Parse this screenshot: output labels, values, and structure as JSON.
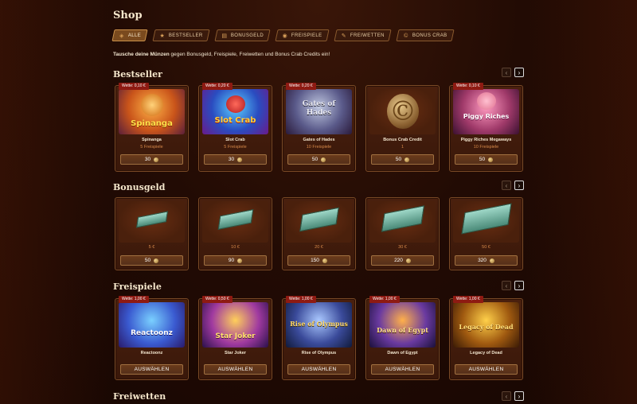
{
  "shop_title": "Shop",
  "filters": [
    {
      "label": "ALLE",
      "icon": "tag-icon",
      "active": true
    },
    {
      "label": "BESTSELLER",
      "icon": "star-icon",
      "active": false
    },
    {
      "label": "BONUSGELD",
      "icon": "cash-icon",
      "active": false
    },
    {
      "label": "FREISPIELE",
      "icon": "spin-coin-icon",
      "active": false
    },
    {
      "label": "FREIWETTEN",
      "icon": "ticket-icon",
      "active": false
    },
    {
      "label": "BONUS CRAB",
      "icon": "crab-coin-icon",
      "active": false
    }
  ],
  "intro": {
    "bold": "Tausche deine Münzen",
    "rest": " gegen Bonusgeld, Freispiele, Freiwetten und Bonus Crab Credits ein!"
  },
  "nav": {
    "prev": "‹",
    "next": "›"
  },
  "sections": {
    "bestseller": {
      "title": "Bestseller",
      "items": [
        {
          "badge": "Wette: 0,10 €",
          "art": "Spinanga",
          "name": "Spinanga",
          "sub": "5 Freispiele",
          "price": "30"
        },
        {
          "badge": "Wette: 0,20 €",
          "art": "Slot Crab",
          "name": "Slot Crab",
          "sub": "5 Freispiele",
          "price": "30"
        },
        {
          "badge": "Wette: 0,20 €",
          "art": "Gates of Hades",
          "name": "Gates of Hades",
          "sub": "10 Freispiele",
          "price": "50"
        },
        {
          "badge": "",
          "art": "",
          "name": "Bonus Crab Credit",
          "sub": "1",
          "price": "50"
        },
        {
          "badge": "Wette: 0,10 €",
          "art": "Piggy Riches",
          "name": "Piggy Riches Megaways",
          "sub": "10 Freispiele",
          "price": "50"
        }
      ]
    },
    "bonusgeld": {
      "title": "Bonusgeld",
      "items": [
        {
          "amount": "5 €",
          "price": "50"
        },
        {
          "amount": "10 €",
          "price": "90"
        },
        {
          "amount": "20 €",
          "price": "150"
        },
        {
          "amount": "30 €",
          "price": "220"
        },
        {
          "amount": "50 €",
          "price": "320"
        }
      ]
    },
    "freispiele": {
      "title": "Freispiele",
      "action_label": "AUSWÄHLEN",
      "items": [
        {
          "badge": "Wette: 1,00 €",
          "art": "Reactoonz",
          "name": "Reactoonz"
        },
        {
          "badge": "Wette: 0,50 €",
          "art": "Star Joker",
          "name": "Star Joker"
        },
        {
          "badge": "Wette: 1,00 €",
          "art": "Rise of Olympus",
          "name": "Rise of Olympus"
        },
        {
          "badge": "Wette: 1,00 €",
          "art": "Dawn of Egypt",
          "name": "Dawn of Egypt"
        },
        {
          "badge": "Wette: 1,00 €",
          "art": "Legacy of Dead",
          "name": "Legacy of Dead"
        }
      ]
    },
    "freiwetten": {
      "title": "Freiwetten"
    }
  }
}
